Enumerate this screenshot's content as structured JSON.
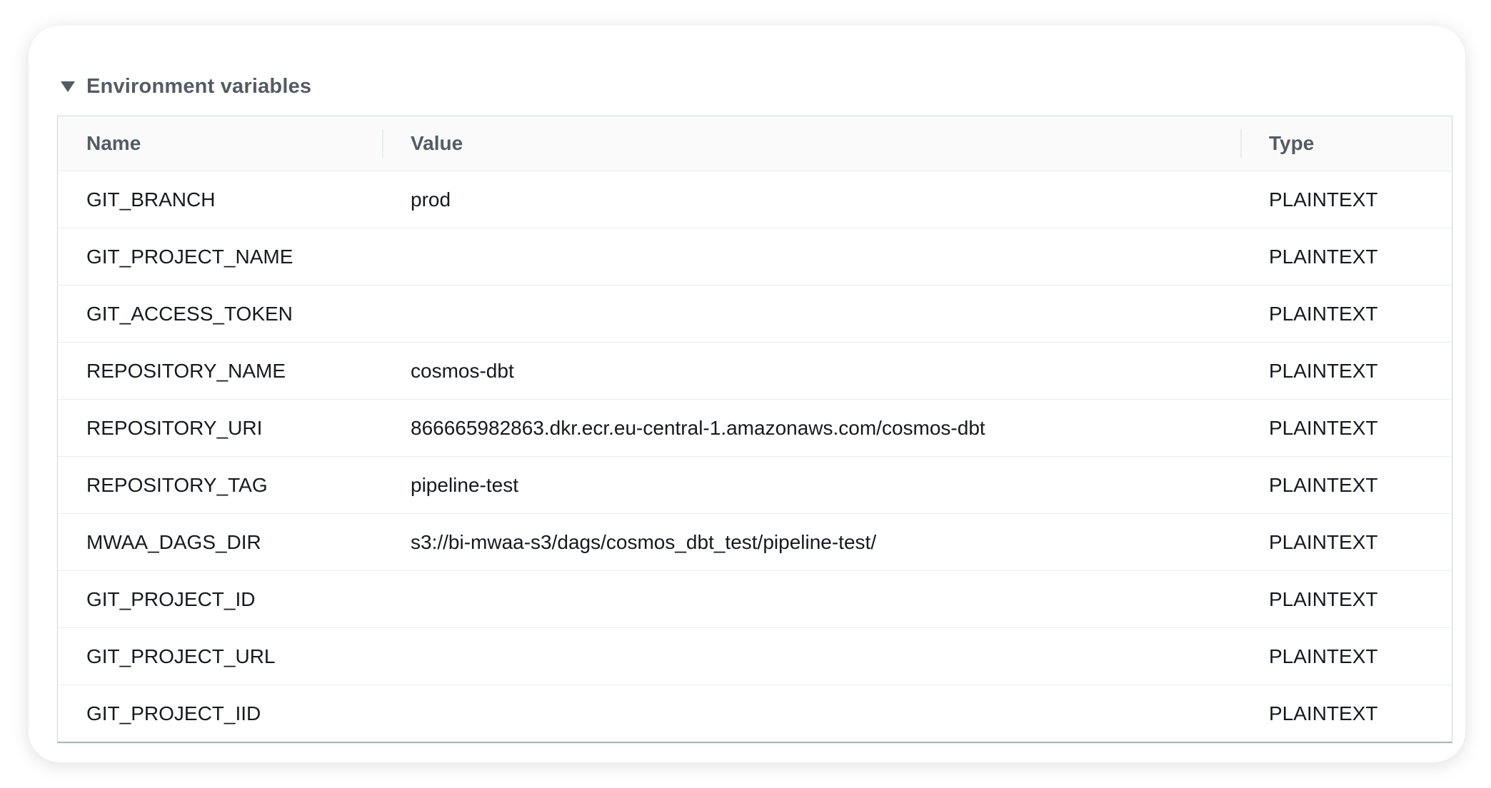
{
  "section": {
    "title": "Environment variables",
    "expanded": true
  },
  "table": {
    "headers": {
      "name": "Name",
      "value": "Value",
      "type": "Type"
    },
    "rows": [
      {
        "name": "GIT_BRANCH",
        "value": "prod",
        "type": "PLAINTEXT"
      },
      {
        "name": "GIT_PROJECT_NAME",
        "value": "",
        "type": "PLAINTEXT"
      },
      {
        "name": "GIT_ACCESS_TOKEN",
        "value": "",
        "type": "PLAINTEXT"
      },
      {
        "name": "REPOSITORY_NAME",
        "value": "cosmos-dbt",
        "type": "PLAINTEXT"
      },
      {
        "name": "REPOSITORY_URI",
        "value": "866665982863.dkr.ecr.eu-central-1.amazonaws.com/cosmos-dbt",
        "type": "PLAINTEXT"
      },
      {
        "name": "REPOSITORY_TAG",
        "value": "pipeline-test",
        "type": "PLAINTEXT"
      },
      {
        "name": "MWAA_DAGS_DIR",
        "value": "s3://bi-mwaa-s3/dags/cosmos_dbt_test/pipeline-test/",
        "type": "PLAINTEXT"
      },
      {
        "name": "GIT_PROJECT_ID",
        "value": "",
        "type": "PLAINTEXT"
      },
      {
        "name": "GIT_PROJECT_URL",
        "value": "",
        "type": "PLAINTEXT"
      },
      {
        "name": "GIT_PROJECT_IID",
        "value": "",
        "type": "PLAINTEXT"
      }
    ]
  },
  "colors": {
    "header_text": "#545b64",
    "body_text": "#16191f",
    "border": "#eaeded",
    "header_bg": "#fafafa"
  },
  "icons": {
    "expand": "caret-down-icon"
  }
}
